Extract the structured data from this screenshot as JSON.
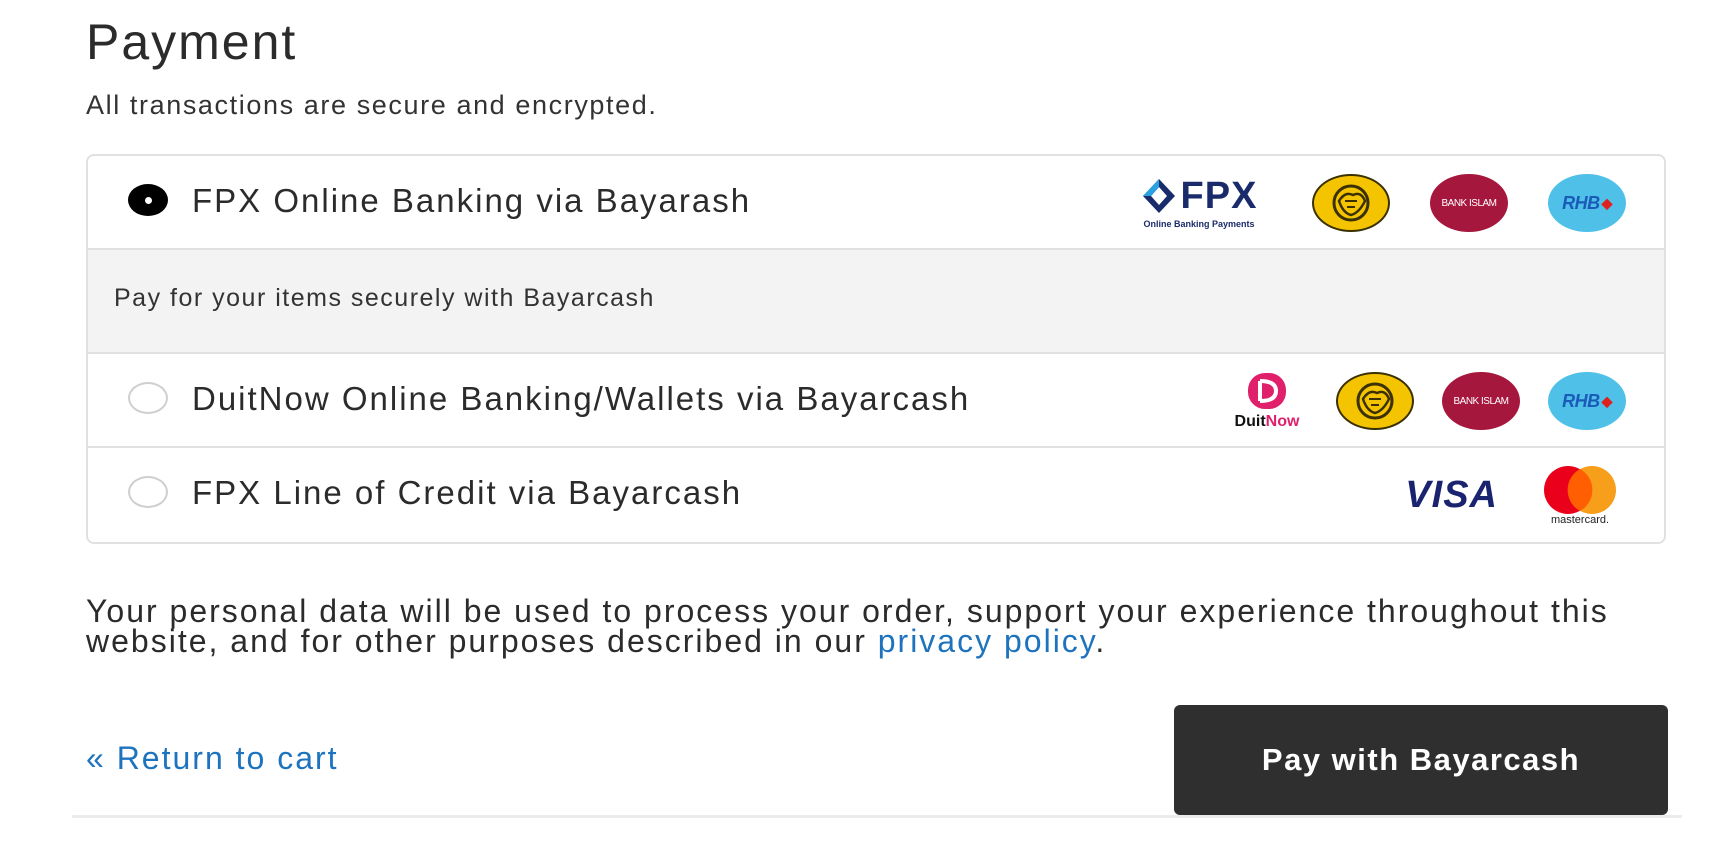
{
  "payment": {
    "title": "Payment",
    "subtitle": "All transactions are secure and encrypted."
  },
  "methods": [
    {
      "label": "FPX Online Banking via Bayarash",
      "selected": true,
      "logos": [
        "fpx-logo",
        "maybank-logo",
        "bank-islam-logo",
        "rhb-logo"
      ]
    },
    {
      "label": "DuitNow Online Banking/Wallets via Bayarcash",
      "selected": false,
      "logos": [
        "duitnow-logo",
        "maybank-logo",
        "bank-islam-logo",
        "rhb-logo"
      ]
    },
    {
      "label": "FPX Line of Credit via Bayarcash",
      "selected": false,
      "logos": [
        "visa-logo",
        "mastercard-logo"
      ]
    }
  ],
  "selected_description": "Pay for your items securely with Bayarcash",
  "logo_text": {
    "fpx": "FPX",
    "fpx_sub": "Online Banking Payments",
    "bank_islam": "BANK ISLAM",
    "rhb": "RHB",
    "duitnow_a": "Duit",
    "duitnow_b": "Now",
    "visa": "VISA",
    "mastercard": "mastercard."
  },
  "privacy": {
    "text": "Your personal data will be used to process your order, support your experience throughout this website, and for other purposes described in our ",
    "link": "privacy policy",
    "end": "."
  },
  "actions": {
    "return_label": "« Return to cart",
    "pay_label": "Pay with Bayarcash"
  },
  "colors": {
    "link": "#1e73be",
    "button_bg": "#2f2f2f",
    "description_bg": "#f3f3f3",
    "border": "#e1e1e1"
  }
}
